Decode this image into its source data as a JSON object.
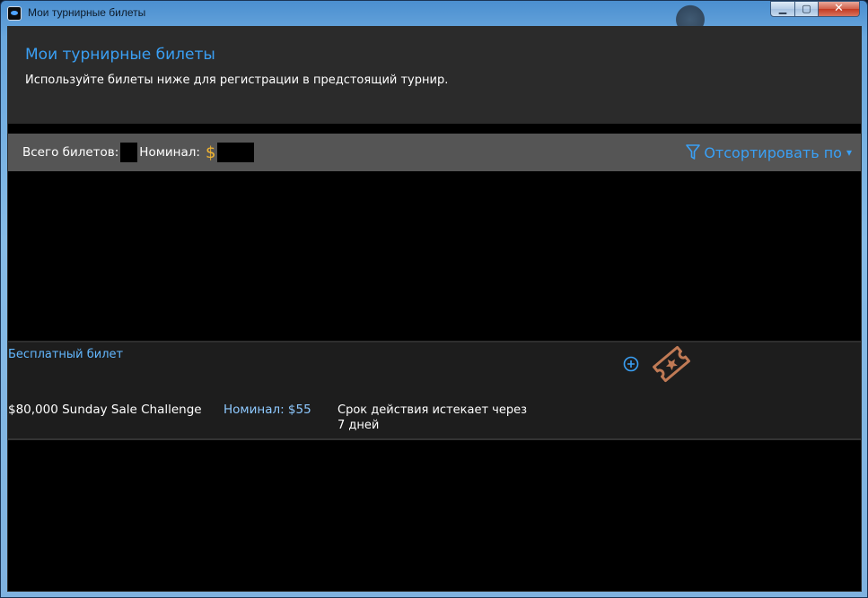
{
  "window": {
    "title": "Мои турнирные билеты",
    "controls": {
      "minimize": "▁",
      "maximize": "▢",
      "close": "✕"
    }
  },
  "header": {
    "title": "Мои турнирные билеты",
    "subtitle": "Используйте билеты ниже для регистрации в предстоящий турнир."
  },
  "summary": {
    "total_label": "Всего билетов:",
    "nominal_label": "Номинал:",
    "currency_symbol": "$",
    "sort_label": "Отсортировать по",
    "sort_caret": "▾"
  },
  "tickets": [
    {
      "type": "Бесплатный билет",
      "name": "$80,000 Sunday Sale Challenge",
      "nominal": "Номинал: $55",
      "expiry_line1": "Срок действия истекает через",
      "expiry_line2": "7 дней",
      "icon": "ticket-star-icon"
    }
  ],
  "colors": {
    "accent": "#3aa0f5",
    "gold": "#f2b531",
    "ticket_bronze": "#c07a55"
  }
}
